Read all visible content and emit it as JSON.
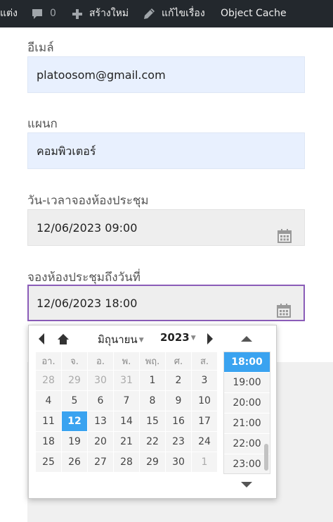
{
  "adminbar": {
    "customize_label": "แต่ง",
    "comments_count": "0",
    "new_label": "สร้างใหม่",
    "edit_label": "แก้ไขเรื่อง",
    "object_cache_label": "Object Cache"
  },
  "form": {
    "email": {
      "label": "อีเมล์",
      "value": "platoosom@gmail.com"
    },
    "department": {
      "label": "แผนก",
      "value": "คอมพิวเตอร์"
    },
    "start_datetime": {
      "label": "วัน-เวลาจองห้องประชุม",
      "value": "12/06/2023 09:00"
    },
    "end_datetime": {
      "label": "จองห้องประชุมถึงวันที่",
      "value": "12/06/2023 18:00"
    }
  },
  "datepicker": {
    "month": "มิถุนายน",
    "year": "2023",
    "weekdays": [
      "อา.",
      "จ.",
      "อ.",
      "พ.",
      "พฤ.",
      "ศ.",
      "ส."
    ],
    "weeks": [
      [
        "28",
        "29",
        "30",
        "31",
        "1",
        "2",
        "3"
      ],
      [
        "4",
        "5",
        "6",
        "7",
        "8",
        "9",
        "10"
      ],
      [
        "11",
        "12",
        "13",
        "14",
        "15",
        "16",
        "17"
      ],
      [
        "18",
        "19",
        "20",
        "21",
        "22",
        "23",
        "24"
      ],
      [
        "25",
        "26",
        "27",
        "28",
        "29",
        "30",
        "1"
      ]
    ],
    "selected_day": "12",
    "times": [
      "18:00",
      "19:00",
      "20:00",
      "21:00",
      "22:00",
      "23:00"
    ],
    "selected_time": "18:00"
  }
}
